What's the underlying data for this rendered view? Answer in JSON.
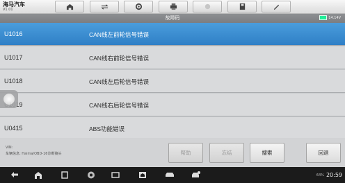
{
  "app": {
    "title": "海马汽车",
    "version": "V1.01"
  },
  "toolbar": {
    "buttons": [
      {
        "name": "home-icon"
      },
      {
        "name": "vehicle-swap-icon"
      },
      {
        "name": "settings-icon"
      },
      {
        "name": "print-icon"
      },
      {
        "name": "help-icon"
      },
      {
        "name": "save-icon"
      },
      {
        "name": "edit-icon"
      }
    ]
  },
  "subbar": {
    "title": "故障码",
    "voltage": "14.14V"
  },
  "dtc_list": [
    {
      "code": "U1016",
      "description": "CAN线左前轮信号错误",
      "selected": true
    },
    {
      "code": "U1017",
      "description": "CAN线右前轮信号错误",
      "selected": false
    },
    {
      "code": "U1018",
      "description": "CAN线左后轮信号错误",
      "selected": false
    },
    {
      "code": "U1019",
      "description": "CAN线右后轮信号错误",
      "selected": false
    },
    {
      "code": "U0415",
      "description": "ABS功能错误",
      "selected": false
    }
  ],
  "footer": {
    "vin_label": "VIN:",
    "vehicle_info": "车辆信息: Haima/OBD-16诊断接头",
    "buttons": {
      "help": "帮助",
      "freeze": "冻结",
      "search": "搜索",
      "back": "回退"
    }
  },
  "navbar": {
    "battery": "64%",
    "time": "20:59"
  },
  "colors": {
    "selected_row": "#3c8fd3",
    "row_bg": "#d9dadc"
  }
}
